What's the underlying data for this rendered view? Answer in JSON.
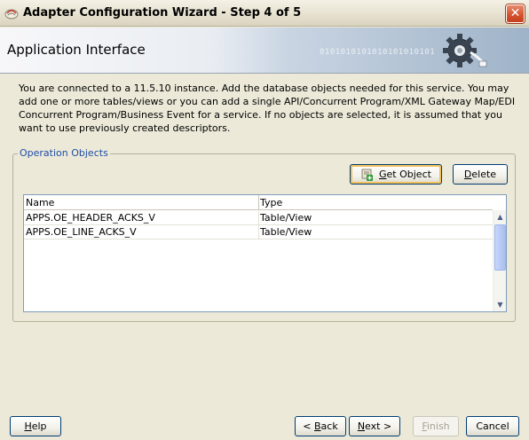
{
  "window": {
    "title": "Adapter Configuration Wizard - Step 4 of 5",
    "close_glyph": "✕",
    "icon": "oracle-jdeveloper-icon"
  },
  "header": {
    "title": "Application Interface",
    "icon": "gear-plug-icon"
  },
  "description": "You are connected to a 11.5.10 instance. Add the database objects needed for this service. You may add one or more tables/views or you can add a single API/Concurrent Program/XML Gateway Map/EDI Concurrent Program/Business Event for a service. If no objects are selected, it is assumed that you want to use previously created descriptors.",
  "operation_objects": {
    "legend": "Operation Objects",
    "get_object": {
      "mnemonic": "G",
      "rest": "et Object"
    },
    "delete": {
      "mnemonic": "D",
      "rest": "elete"
    },
    "columns": [
      "Name",
      "Type"
    ],
    "rows": [
      {
        "name": "APPS.OE_HEADER_ACKS_V",
        "type": "Table/View"
      },
      {
        "name": "APPS.OE_LINE_ACKS_V",
        "type": "Table/View"
      }
    ]
  },
  "footer": {
    "help": {
      "mnemonic": "H",
      "rest": "elp"
    },
    "back": {
      "prefix": "< ",
      "mnemonic": "B",
      "rest": "ack"
    },
    "next": {
      "mnemonic": "N",
      "rest": "ext >"
    },
    "finish": {
      "mnemonic": "F",
      "rest": "inish"
    },
    "cancel": {
      "label": "Cancel"
    }
  },
  "colors": {
    "legend": "#1f4fa7",
    "close_button": "#d4512e",
    "focus_ring": "#f2c15b"
  }
}
